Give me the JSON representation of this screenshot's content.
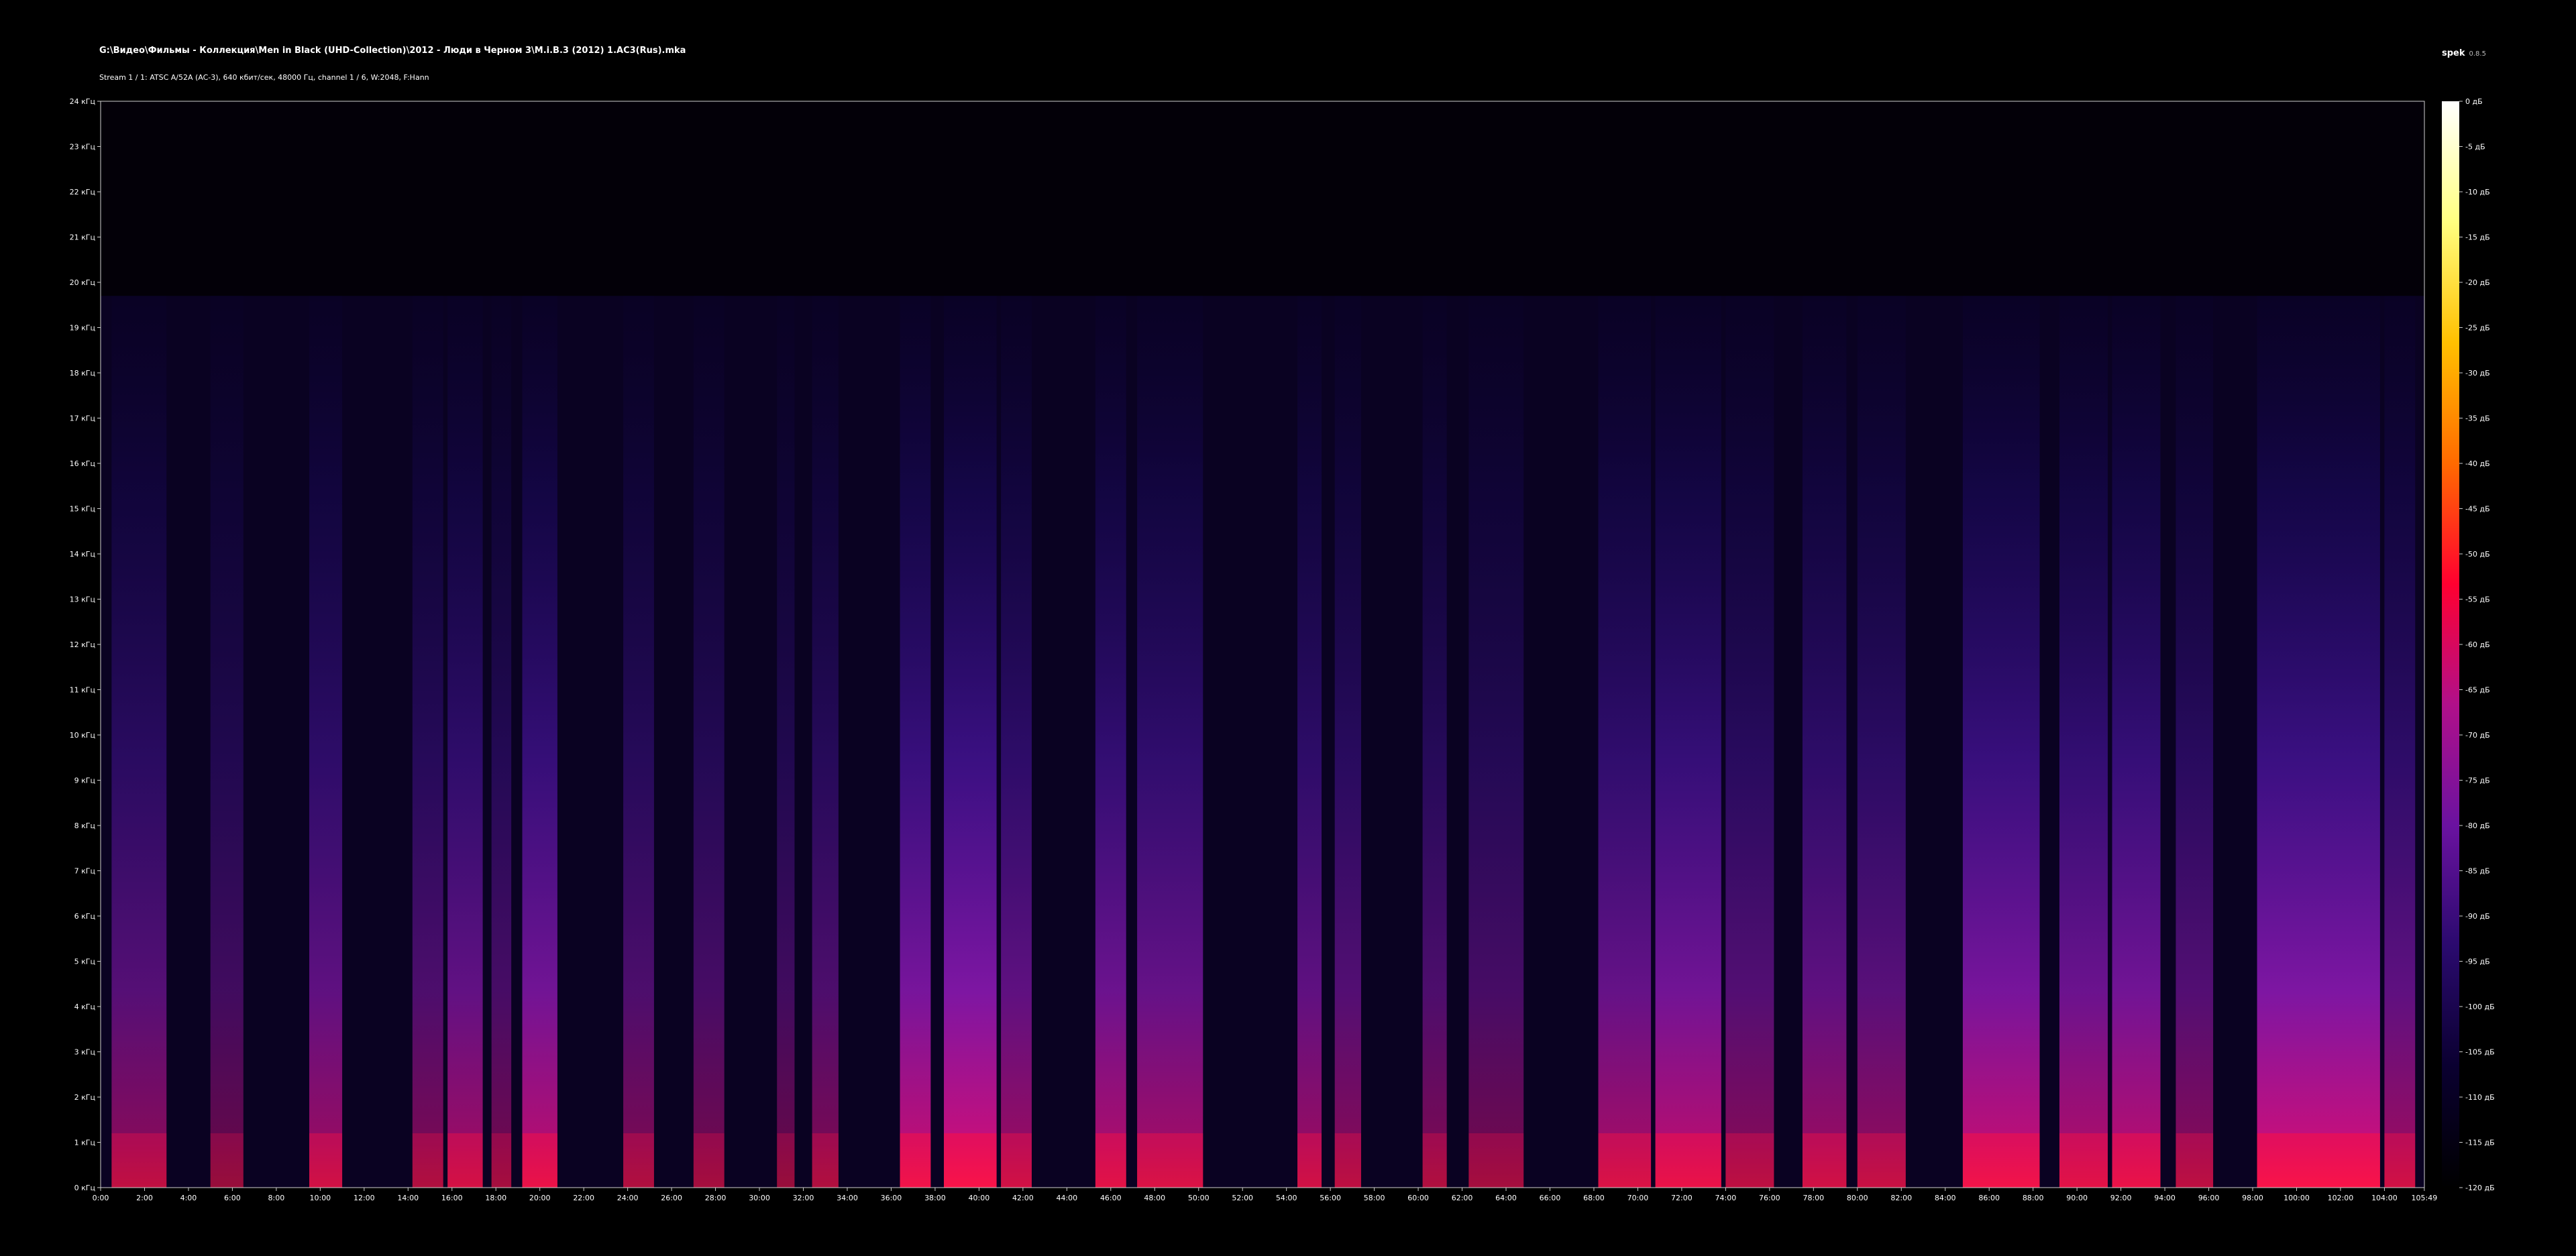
{
  "header": {
    "file_path": "G:\\Видео\\Фильмы - Коллекция\\Men in Black (UHD-Collection)\\2012 - Люди в Черном 3\\M.i.B.3 (2012) 1.AC3(Rus).mka",
    "stream_info": "Stream 1 / 1: ATSC A/52A (AC-3), 640 кбит/сек, 48000 Гц, channel 1 / 6, W:2048, F:Hann",
    "app_name": "spek",
    "app_version": "0.8.5"
  },
  "chart_data": {
    "type": "heatmap",
    "subtype": "spectrogram",
    "title": "",
    "xlabel": "",
    "ylabel": "",
    "x_ticks": [
      "0:00",
      "2:00",
      "4:00",
      "6:00",
      "8:00",
      "10:00",
      "12:00",
      "14:00",
      "16:00",
      "18:00",
      "20:00",
      "22:00",
      "24:00",
      "26:00",
      "28:00",
      "30:00",
      "32:00",
      "34:00",
      "36:00",
      "38:00",
      "40:00",
      "42:00",
      "44:00",
      "46:00",
      "48:00",
      "50:00",
      "52:00",
      "54:00",
      "56:00",
      "58:00",
      "60:00",
      "62:00",
      "64:00",
      "66:00",
      "68:00",
      "70:00",
      "72:00",
      "74:00",
      "76:00",
      "78:00",
      "80:00",
      "82:00",
      "84:00",
      "86:00",
      "88:00",
      "90:00",
      "92:00",
      "94:00",
      "96:00",
      "98:00",
      "100:00",
      "102:00",
      "104:00",
      "105:49"
    ],
    "x_range_minutes": [
      0,
      105.82
    ],
    "y_ticks": [
      "0 кГц",
      "1 кГц",
      "2 кГц",
      "3 кГц",
      "4 кГц",
      "5 кГц",
      "6 кГц",
      "7 кГц",
      "8 кГц",
      "9 кГц",
      "10 кГц",
      "11 кГц",
      "12 кГц",
      "13 кГц",
      "14 кГц",
      "15 кГц",
      "16 кГц",
      "17 кГц",
      "18 кГц",
      "19 кГц",
      "20 кГц",
      "21 кГц",
      "22 кГц",
      "23 кГц",
      "24 кГц"
    ],
    "y_range_khz": [
      0,
      24
    ],
    "frequency_cutoff_khz": 19.7,
    "colorbar_ticks": [
      "0 дБ",
      "-5 дБ",
      "-10 дБ",
      "-15 дБ",
      "-20 дБ",
      "-25 дБ",
      "-30 дБ",
      "-35 дБ",
      "-40 дБ",
      "-45 дБ",
      "-50 дБ",
      "-55 дБ",
      "-60 дБ",
      "-65 дБ",
      "-70 дБ",
      "-75 дБ",
      "-80 дБ",
      "-85 дБ",
      "-90 дБ",
      "-95 дБ",
      "-100 дБ",
      "-105 дБ",
      "-110 дБ",
      "-115 дБ",
      "-120 дБ"
    ],
    "colorbar_range_db": [
      -120,
      0
    ],
    "colormap": [
      "#000000",
      "#0a0030",
      "#2a0a6e",
      "#6a12a0",
      "#b0108a",
      "#ff0030",
      "#ff6a00",
      "#ffc000",
      "#ffff80",
      "#ffffff"
    ],
    "loud_segments_minutes": [
      [
        0.5,
        3.0,
        0.62
      ],
      [
        5.0,
        6.5,
        0.45
      ],
      [
        9.5,
        11.0,
        0.7
      ],
      [
        14.2,
        15.6,
        0.55
      ],
      [
        15.8,
        17.4,
        0.72
      ],
      [
        17.8,
        18.7,
        0.5
      ],
      [
        19.2,
        20.8,
        0.85
      ],
      [
        23.8,
        25.2,
        0.55
      ],
      [
        27.0,
        28.4,
        0.5
      ],
      [
        30.8,
        31.6,
        0.45
      ],
      [
        32.4,
        33.6,
        0.55
      ],
      [
        36.4,
        37.8,
        0.9
      ],
      [
        38.4,
        40.8,
        0.95
      ],
      [
        41.0,
        42.4,
        0.7
      ],
      [
        45.3,
        46.7,
        0.8
      ],
      [
        47.2,
        50.2,
        0.75
      ],
      [
        54.5,
        55.6,
        0.7
      ],
      [
        56.2,
        57.4,
        0.6
      ],
      [
        60.2,
        61.3,
        0.55
      ],
      [
        62.3,
        64.8,
        0.5
      ],
      [
        68.2,
        70.6,
        0.75
      ],
      [
        70.8,
        73.8,
        0.85
      ],
      [
        74.0,
        76.2,
        0.6
      ],
      [
        77.5,
        79.5,
        0.7
      ],
      [
        80.0,
        82.2,
        0.65
      ],
      [
        84.8,
        88.3,
        0.9
      ],
      [
        89.2,
        91.4,
        0.8
      ],
      [
        91.6,
        93.8,
        0.85
      ],
      [
        94.5,
        96.2,
        0.6
      ],
      [
        98.2,
        103.8,
        0.95
      ],
      [
        104.0,
        105.4,
        0.7
      ]
    ]
  }
}
